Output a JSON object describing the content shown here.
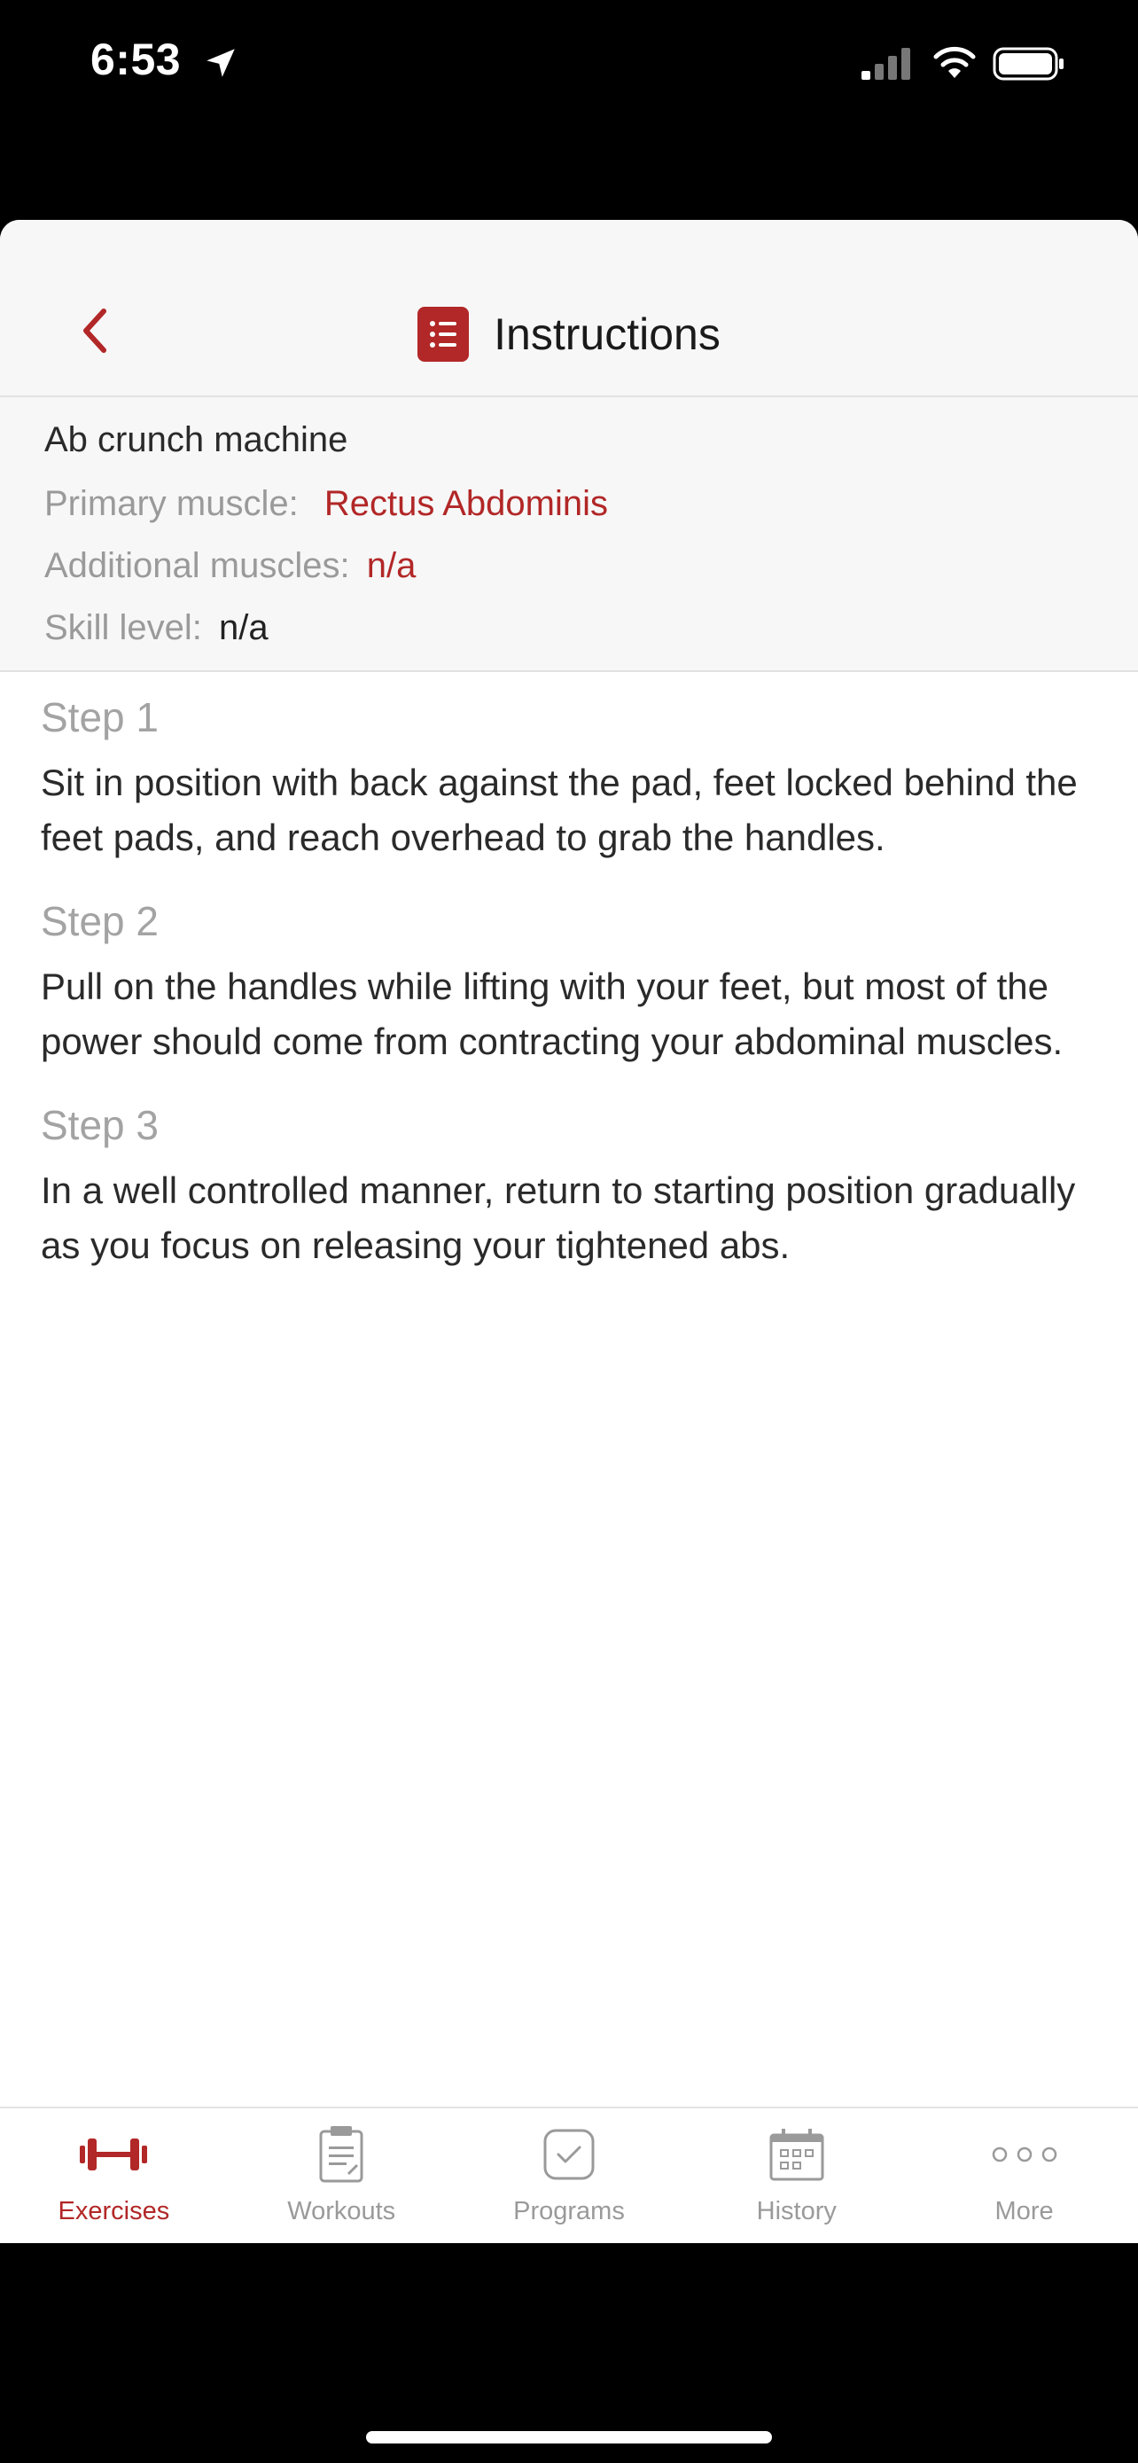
{
  "status_bar": {
    "time": "6:53"
  },
  "header": {
    "title": "Instructions"
  },
  "exercise": {
    "name": "Ab crunch machine",
    "primary_label": "Primary muscle:",
    "primary_value": "Rectus Abdominis",
    "additional_label": "Additional muscles:",
    "additional_value": "n/a",
    "skill_label": "Skill level:",
    "skill_value": "n/a"
  },
  "steps": [
    {
      "title": "Step 1",
      "text": "Sit in position with back against the pad, feet locked behind the feet pads, and reach overhead to grab the handles."
    },
    {
      "title": "Step 2",
      "text": "Pull on the handles while lifting with your feet, but most of the power should come from contracting your abdominal muscles."
    },
    {
      "title": "Step 3",
      "text": "In a well controlled manner, return to starting position gradually as you focus on releasing your tightened abs."
    }
  ],
  "tabbar": {
    "tabs": [
      {
        "label": "Exercises",
        "icon": "dumbbell-icon",
        "active": true
      },
      {
        "label": "Workouts",
        "icon": "clipboard-icon",
        "active": false
      },
      {
        "label": "Programs",
        "icon": "checkbox-icon",
        "active": false
      },
      {
        "label": "History",
        "icon": "calendar-icon",
        "active": false
      },
      {
        "label": "More",
        "icon": "more-dots-icon",
        "active": false
      }
    ]
  },
  "colors": {
    "accent": "#b22727",
    "muted": "#9a9a9a",
    "header_bg": "#f7f7f7"
  }
}
